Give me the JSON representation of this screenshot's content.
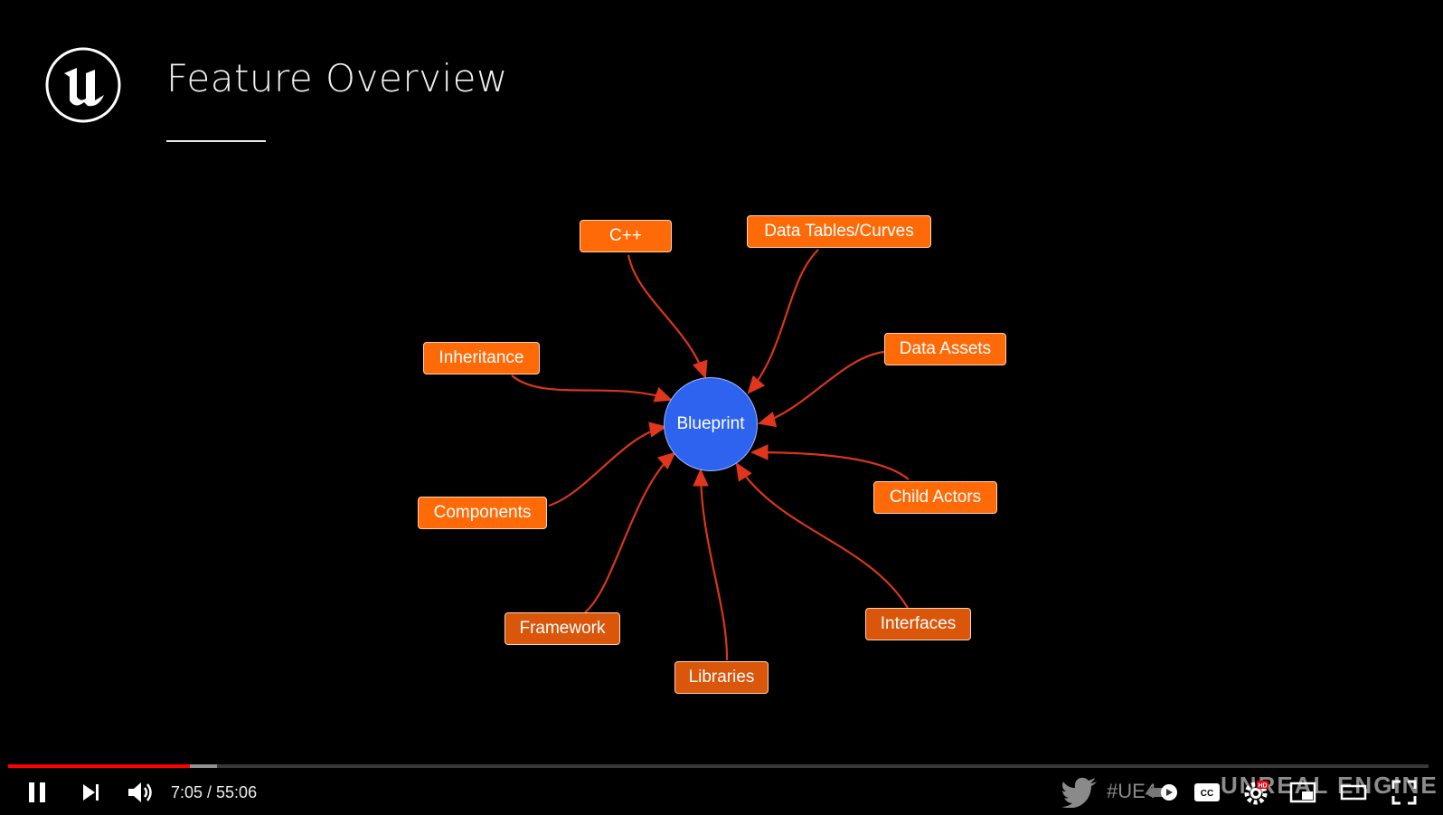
{
  "slide": {
    "title": "Feature Overview"
  },
  "diagram": {
    "center": "Blueprint",
    "nodes": [
      {
        "id": "cpp",
        "label": "C++"
      },
      {
        "id": "data-tables",
        "label": "Data Tables/Curves"
      },
      {
        "id": "data-assets",
        "label": "Data Assets"
      },
      {
        "id": "inheritance",
        "label": "Inheritance"
      },
      {
        "id": "child-actors",
        "label": "Child Actors"
      },
      {
        "id": "components",
        "label": "Components"
      },
      {
        "id": "framework",
        "label": "Framework"
      },
      {
        "id": "libraries",
        "label": "Libraries"
      },
      {
        "id": "interfaces",
        "label": "Interfaces"
      }
    ],
    "edge_color": "#e0361c",
    "node_color": "#ff6a08",
    "center_color": "#2e63f0"
  },
  "player": {
    "time_current": "7:05",
    "time_total": "55:06",
    "time_text": "7:05 / 55:06",
    "progress_played": 0.128,
    "progress_buffered": 0.147,
    "hashtag": "#UE4",
    "brand": "UNREAL ENGINE",
    "icons": [
      "pause-icon",
      "next-icon",
      "volume-icon",
      "twitter-icon",
      "autoplay-icon",
      "captions-icon",
      "settings-icon",
      "miniplayer-icon",
      "theater-icon",
      "fullscreen-icon"
    ],
    "progress_color": "#ff0000"
  }
}
